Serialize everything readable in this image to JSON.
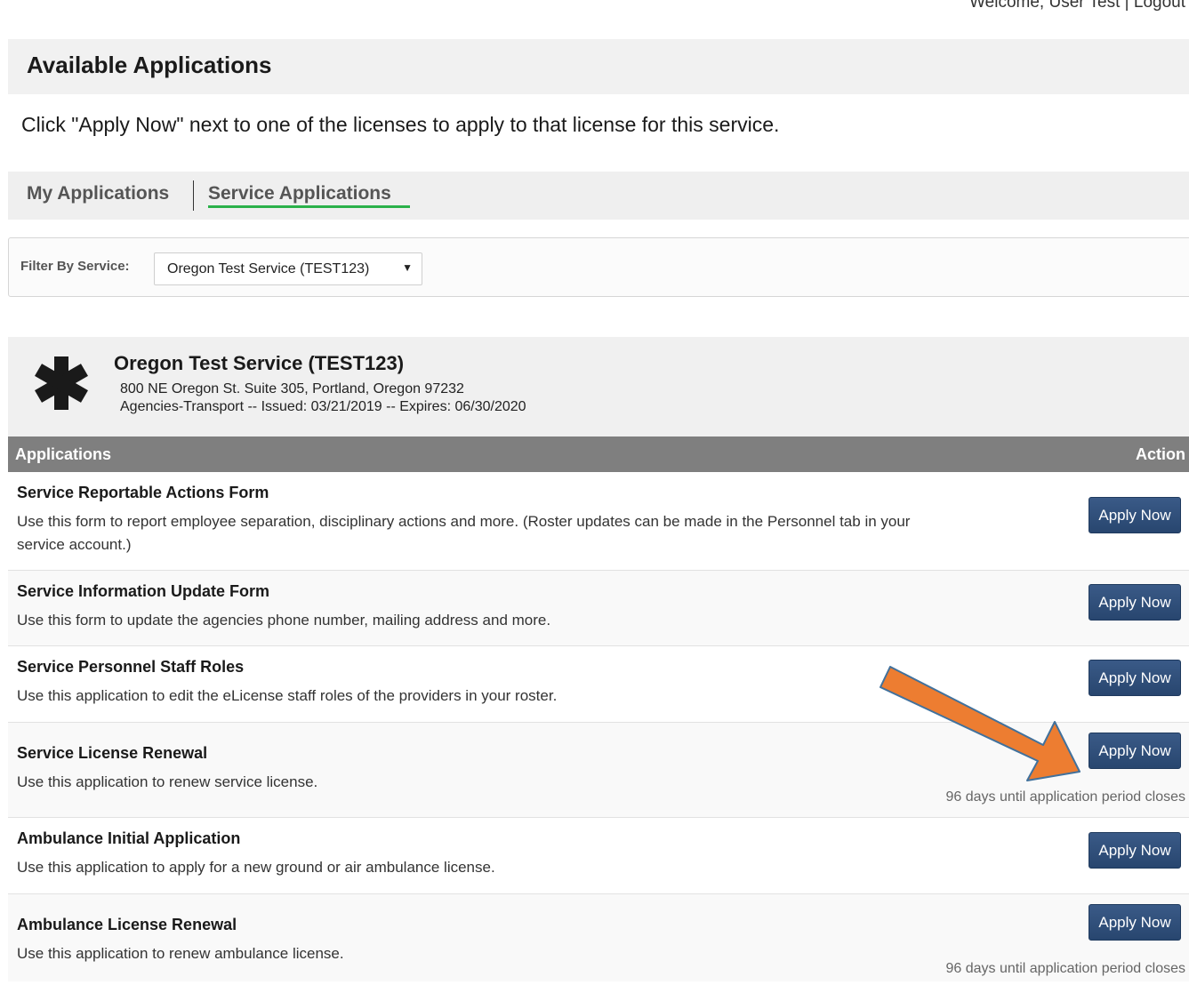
{
  "topbar": {
    "welcome": "Welcome, User Test | Logout"
  },
  "header": {
    "title": "Available Applications"
  },
  "instructions": "Click \"Apply Now\" next to one of the licenses to apply to that license for this service.",
  "tabs": [
    {
      "label": "My Applications",
      "active": false
    },
    {
      "label": "Service Applications",
      "active": true
    }
  ],
  "filter": {
    "label": "Filter By Service:",
    "selected": "Oregon Test Service (TEST123)"
  },
  "service": {
    "icon": "star-of-life-icon",
    "name": "Oregon Test Service (TEST123)",
    "address": "800 NE Oregon St. Suite 305, Portland, Oregon 97232",
    "meta": "Agencies-Transport -- Issued: 03/21/2019 -- Expires: 06/30/2020"
  },
  "table": {
    "columns": [
      "Applications",
      "Action"
    ],
    "button_label": "Apply Now",
    "rows": [
      {
        "title": "Service Reportable Actions Form",
        "description": "Use this form to report employee separation, disciplinary actions and more. (Roster updates can be made in the Personnel tab in your service account.)",
        "note": ""
      },
      {
        "title": "Service Information Update Form",
        "description": "Use this form to update the agencies phone number, mailing address and more.",
        "note": ""
      },
      {
        "title": "Service Personnel Staff Roles",
        "description": "Use this application to edit the eLicense staff roles of the providers in your roster.",
        "note": ""
      },
      {
        "title": "Service License Renewal",
        "description": "Use this application to renew service license.",
        "note": "96 days until application period closes"
      },
      {
        "title": "Ambulance Initial Application",
        "description": "Use this application to apply for a new ground or air ambulance license.",
        "note": ""
      },
      {
        "title": "Ambulance License Renewal",
        "description": "Use this application to renew ambulance license.",
        "note": "96 days until application period closes"
      }
    ]
  },
  "annotation": {
    "icon": "orange-arrow-icon",
    "color": "#ed7d31"
  }
}
